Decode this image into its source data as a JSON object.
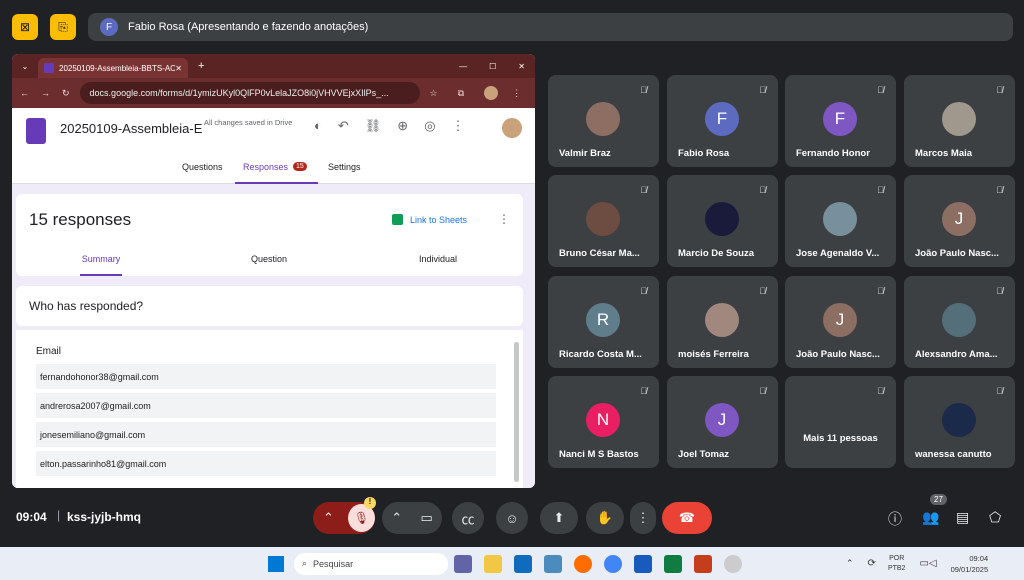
{
  "meeting": {
    "presenter": "Fabio Rosa (Apresentando e fazendo anotações)",
    "presenter_initial": "F",
    "time": "09:04",
    "code": "kss-jyjb-hmq",
    "participants_count": "27",
    "mic_warning": "!"
  },
  "browser": {
    "tab_title": "20250109-Assembleia-BBTS-AC",
    "url": "docs.google.com/forms/d/1ymizUKyl0QlFP0vLelaJZO8i0jVHVVEjxXIlPs_..."
  },
  "form": {
    "title": "20250109-Assembleia-E",
    "save_status": "All changes saved in Drive",
    "tabs": [
      "Questions",
      "Responses",
      "Settings"
    ],
    "responses_badge": "15",
    "response_count": "15 responses",
    "link_sheets": "Link to Sheets",
    "subtabs": [
      "Summary",
      "Question",
      "Individual"
    ],
    "who_responded": "Who has responded?",
    "email_header": "Email",
    "emails": [
      "fernandohonor38@gmail.com",
      "andrerosa2007@gmail.com",
      "jonesemiliano@gmail.com",
      "elton.passarinho81@gmail.com"
    ]
  },
  "tiles": [
    {
      "name": "Valmir Braz",
      "initial": "",
      "color": "#8d6e63"
    },
    {
      "name": "Fabio Rosa",
      "initial": "F",
      "color": "#5c6bc0"
    },
    {
      "name": "Fernando Honor",
      "initial": "F",
      "color": "#7e57c2"
    },
    {
      "name": "Marcos Maia",
      "initial": "",
      "color": "#a0988c"
    },
    {
      "name": "Bruno César Ma...",
      "initial": "",
      "color": "#6d4c41"
    },
    {
      "name": "Marcio De Souza",
      "initial": "",
      "color": "#1a1a3a"
    },
    {
      "name": "Jose Agenaldo V...",
      "initial": "",
      "color": "#78909c"
    },
    {
      "name": "João Paulo Nasc...",
      "initial": "J",
      "color": "#8d6e63"
    },
    {
      "name": "Ricardo Costa M...",
      "initial": "R",
      "color": "#607d8b"
    },
    {
      "name": "moisés Ferreira",
      "initial": "",
      "color": "#a1887f"
    },
    {
      "name": "João Paulo Nasc...",
      "initial": "J",
      "color": "#8d6e63"
    },
    {
      "name": "Alexsandro Ama...",
      "initial": "",
      "color": "#546e7a"
    },
    {
      "name": "Nanci M S Bastos",
      "initial": "N",
      "color": "#e91e63"
    },
    {
      "name": "Joel Tomaz",
      "initial": "J",
      "color": "#7e57c2"
    },
    {
      "name": "Mais 11 pessoas",
      "initial": "",
      "color": "#3c4043"
    },
    {
      "name": "wanessa canutto",
      "initial": "",
      "color": "#1c2a4a"
    }
  ],
  "taskbar": {
    "search": "Pesquisar",
    "lang1": "POR",
    "lang2": "PTB2",
    "clock_time": "09:04",
    "clock_date": "09/01/2025"
  }
}
